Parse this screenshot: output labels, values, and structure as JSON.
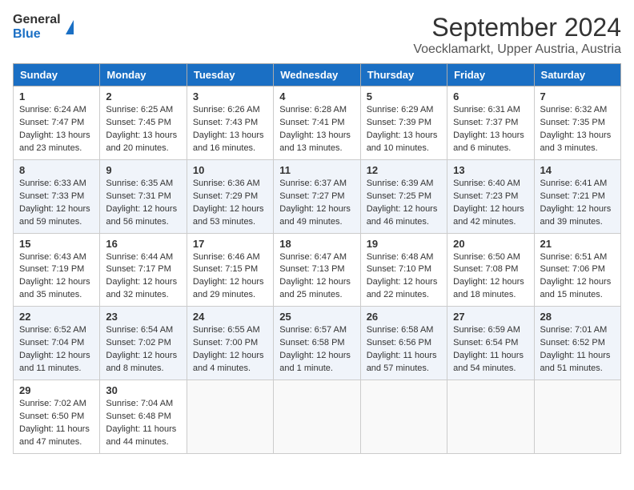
{
  "header": {
    "logo_general": "General",
    "logo_blue": "Blue",
    "title": "September 2024",
    "subtitle": "Voecklamarkt, Upper Austria, Austria"
  },
  "calendar": {
    "weekdays": [
      "Sunday",
      "Monday",
      "Tuesday",
      "Wednesday",
      "Thursday",
      "Friday",
      "Saturday"
    ],
    "weeks": [
      [
        {
          "day": "1",
          "info": "Sunrise: 6:24 AM\nSunset: 7:47 PM\nDaylight: 13 hours\nand 23 minutes."
        },
        {
          "day": "2",
          "info": "Sunrise: 6:25 AM\nSunset: 7:45 PM\nDaylight: 13 hours\nand 20 minutes."
        },
        {
          "day": "3",
          "info": "Sunrise: 6:26 AM\nSunset: 7:43 PM\nDaylight: 13 hours\nand 16 minutes."
        },
        {
          "day": "4",
          "info": "Sunrise: 6:28 AM\nSunset: 7:41 PM\nDaylight: 13 hours\nand 13 minutes."
        },
        {
          "day": "5",
          "info": "Sunrise: 6:29 AM\nSunset: 7:39 PM\nDaylight: 13 hours\nand 10 minutes."
        },
        {
          "day": "6",
          "info": "Sunrise: 6:31 AM\nSunset: 7:37 PM\nDaylight: 13 hours\nand 6 minutes."
        },
        {
          "day": "7",
          "info": "Sunrise: 6:32 AM\nSunset: 7:35 PM\nDaylight: 13 hours\nand 3 minutes."
        }
      ],
      [
        {
          "day": "8",
          "info": "Sunrise: 6:33 AM\nSunset: 7:33 PM\nDaylight: 12 hours\nand 59 minutes."
        },
        {
          "day": "9",
          "info": "Sunrise: 6:35 AM\nSunset: 7:31 PM\nDaylight: 12 hours\nand 56 minutes."
        },
        {
          "day": "10",
          "info": "Sunrise: 6:36 AM\nSunset: 7:29 PM\nDaylight: 12 hours\nand 53 minutes."
        },
        {
          "day": "11",
          "info": "Sunrise: 6:37 AM\nSunset: 7:27 PM\nDaylight: 12 hours\nand 49 minutes."
        },
        {
          "day": "12",
          "info": "Sunrise: 6:39 AM\nSunset: 7:25 PM\nDaylight: 12 hours\nand 46 minutes."
        },
        {
          "day": "13",
          "info": "Sunrise: 6:40 AM\nSunset: 7:23 PM\nDaylight: 12 hours\nand 42 minutes."
        },
        {
          "day": "14",
          "info": "Sunrise: 6:41 AM\nSunset: 7:21 PM\nDaylight: 12 hours\nand 39 minutes."
        }
      ],
      [
        {
          "day": "15",
          "info": "Sunrise: 6:43 AM\nSunset: 7:19 PM\nDaylight: 12 hours\nand 35 minutes."
        },
        {
          "day": "16",
          "info": "Sunrise: 6:44 AM\nSunset: 7:17 PM\nDaylight: 12 hours\nand 32 minutes."
        },
        {
          "day": "17",
          "info": "Sunrise: 6:46 AM\nSunset: 7:15 PM\nDaylight: 12 hours\nand 29 minutes."
        },
        {
          "day": "18",
          "info": "Sunrise: 6:47 AM\nSunset: 7:13 PM\nDaylight: 12 hours\nand 25 minutes."
        },
        {
          "day": "19",
          "info": "Sunrise: 6:48 AM\nSunset: 7:10 PM\nDaylight: 12 hours\nand 22 minutes."
        },
        {
          "day": "20",
          "info": "Sunrise: 6:50 AM\nSunset: 7:08 PM\nDaylight: 12 hours\nand 18 minutes."
        },
        {
          "day": "21",
          "info": "Sunrise: 6:51 AM\nSunset: 7:06 PM\nDaylight: 12 hours\nand 15 minutes."
        }
      ],
      [
        {
          "day": "22",
          "info": "Sunrise: 6:52 AM\nSunset: 7:04 PM\nDaylight: 12 hours\nand 11 minutes."
        },
        {
          "day": "23",
          "info": "Sunrise: 6:54 AM\nSunset: 7:02 PM\nDaylight: 12 hours\nand 8 minutes."
        },
        {
          "day": "24",
          "info": "Sunrise: 6:55 AM\nSunset: 7:00 PM\nDaylight: 12 hours\nand 4 minutes."
        },
        {
          "day": "25",
          "info": "Sunrise: 6:57 AM\nSunset: 6:58 PM\nDaylight: 12 hours\nand 1 minute."
        },
        {
          "day": "26",
          "info": "Sunrise: 6:58 AM\nSunset: 6:56 PM\nDaylight: 11 hours\nand 57 minutes."
        },
        {
          "day": "27",
          "info": "Sunrise: 6:59 AM\nSunset: 6:54 PM\nDaylight: 11 hours\nand 54 minutes."
        },
        {
          "day": "28",
          "info": "Sunrise: 7:01 AM\nSunset: 6:52 PM\nDaylight: 11 hours\nand 51 minutes."
        }
      ],
      [
        {
          "day": "29",
          "info": "Sunrise: 7:02 AM\nSunset: 6:50 PM\nDaylight: 11 hours\nand 47 minutes."
        },
        {
          "day": "30",
          "info": "Sunrise: 7:04 AM\nSunset: 6:48 PM\nDaylight: 11 hours\nand 44 minutes."
        },
        {
          "day": "",
          "info": ""
        },
        {
          "day": "",
          "info": ""
        },
        {
          "day": "",
          "info": ""
        },
        {
          "day": "",
          "info": ""
        },
        {
          "day": "",
          "info": ""
        }
      ]
    ]
  }
}
